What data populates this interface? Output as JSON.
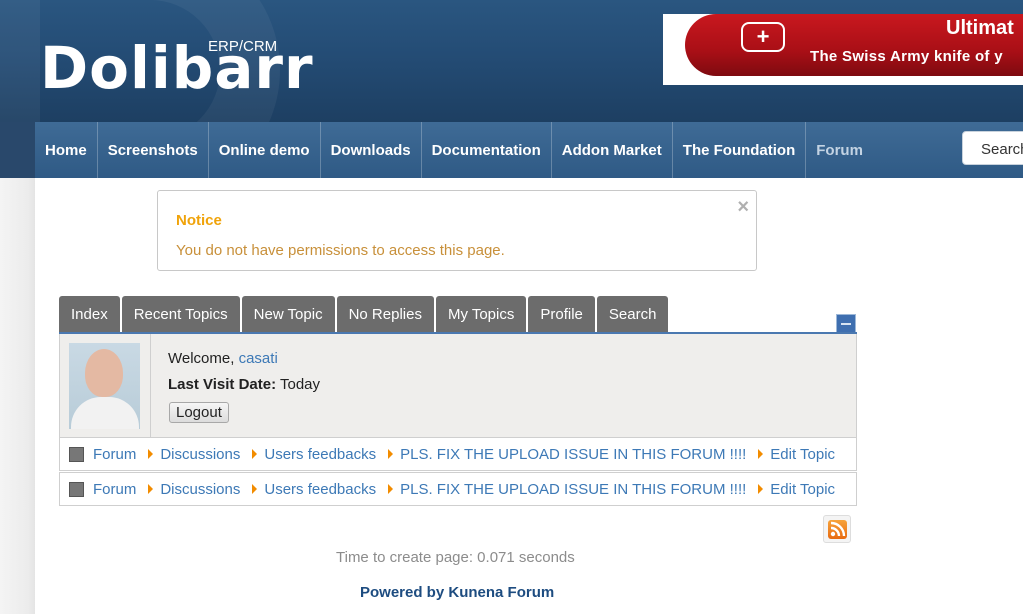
{
  "brand": {
    "name": "Dolibarr",
    "subtitle": "ERP/CRM"
  },
  "banner": {
    "title": "Ultimat",
    "subtitle": "The Swiss Army knife of y"
  },
  "nav": {
    "items": [
      "Home",
      "Screenshots",
      "Online demo",
      "Downloads",
      "Documentation",
      "Addon Market",
      "The Foundation",
      "Forum"
    ],
    "active": "Forum",
    "search_label": "Search"
  },
  "notice": {
    "title": "Notice",
    "message": "You do not have permissions to access this page.",
    "close": "×"
  },
  "tabs": [
    "Index",
    "Recent Topics",
    "New Topic",
    "No Replies",
    "My Topics",
    "Profile",
    "Search"
  ],
  "profile": {
    "welcome_label": "Welcome,",
    "username": "casati",
    "last_visit_label": "Last Visit Date:",
    "last_visit_value": "Today",
    "logout_label": "Logout"
  },
  "breadcrumbs": [
    [
      "Forum",
      "Discussions",
      "Users feedbacks",
      "PLS. FIX THE UPLOAD ISSUE IN THIS FORUM !!!!",
      "Edit Topic"
    ],
    [
      "Forum",
      "Discussions",
      "Users feedbacks",
      "PLS. FIX THE UPLOAD ISSUE IN THIS FORUM !!!!",
      "Edit Topic"
    ]
  ],
  "footer": {
    "timer": "Time to create page: 0.071 seconds",
    "powered": "Powered by Kunena Forum"
  },
  "colors": {
    "nav_bg": "#2f5a85",
    "notice_title": "#f0a30a",
    "link": "#3d79b6",
    "tab_bg": "#6c6c6c"
  }
}
